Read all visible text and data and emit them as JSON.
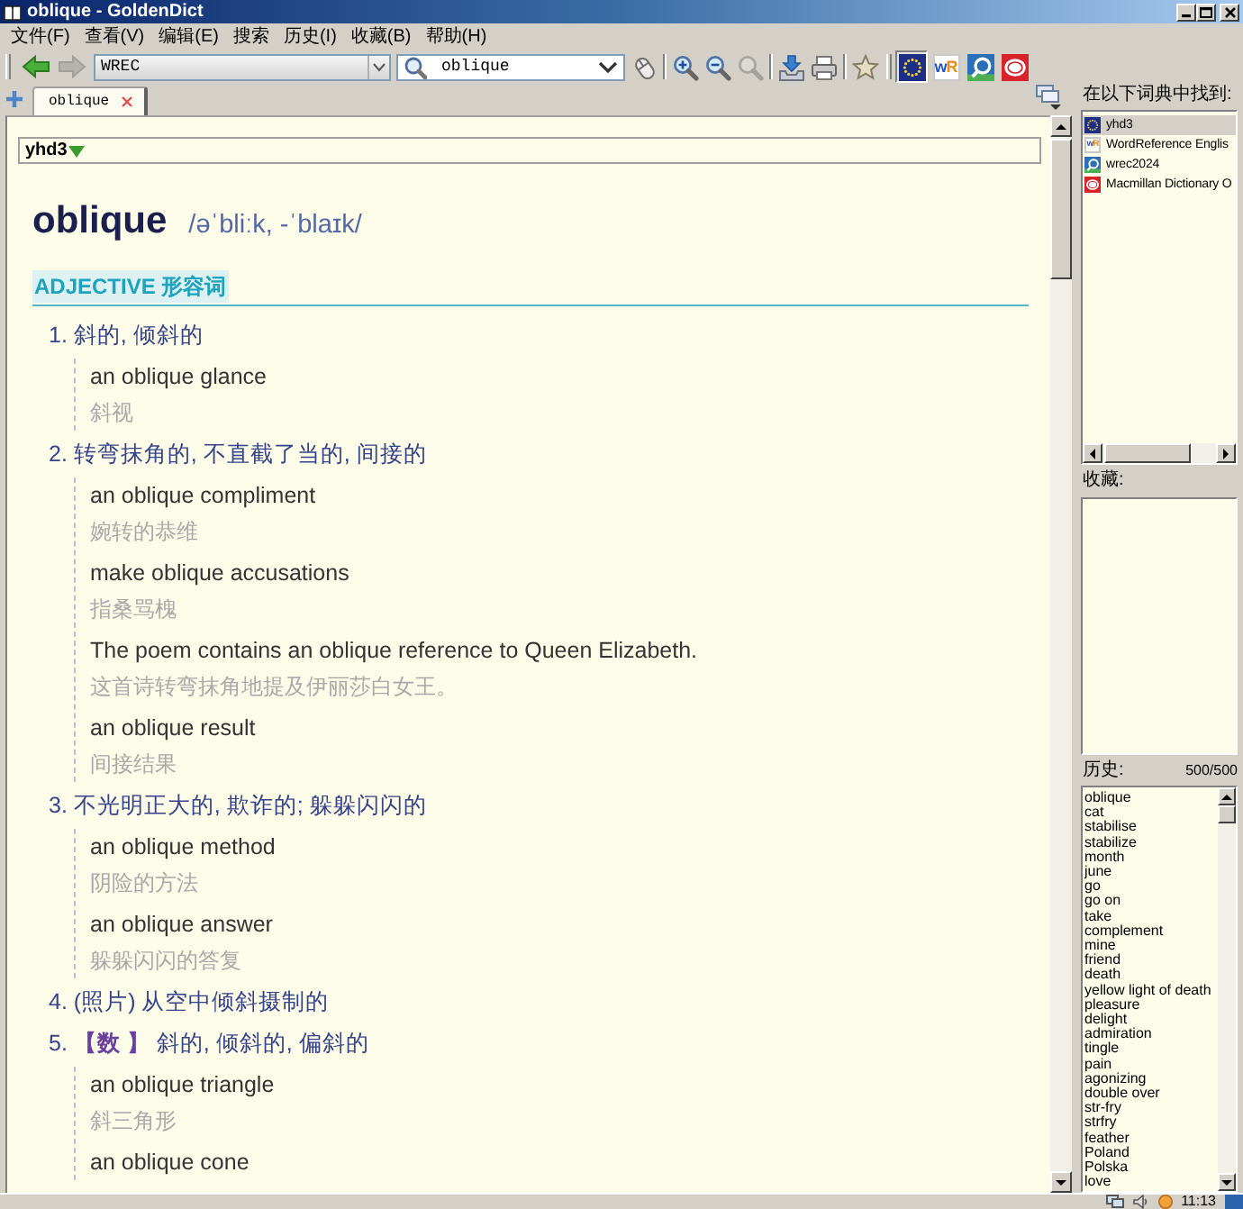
{
  "window": {
    "title": "oblique - GoldenDict"
  },
  "menu": [
    "文件(F)",
    "查看(V)",
    "编辑(E)",
    "搜索",
    "历史(I)",
    "收藏(B)",
    "帮助(H)"
  ],
  "toolbar": {
    "navigation": [
      {
        "kind": "back",
        "disabled": false
      },
      {
        "kind": "forward",
        "disabled": true
      }
    ],
    "dictionary_group": "WREC",
    "search": {
      "value": "oblique"
    },
    "tools": [
      {
        "kind": "scan",
        "disabled": false
      },
      {
        "kind": "zoom_in",
        "disabled": false
      },
      {
        "kind": "zoom_out",
        "disabled": false
      },
      {
        "kind": "zoom_reset",
        "disabled": true
      },
      {
        "kind": "save",
        "disabled": false
      },
      {
        "kind": "print",
        "disabled": false
      },
      {
        "kind": "favorite",
        "disabled": false
      }
    ],
    "dictionaries": [
      {
        "kind": "flag",
        "selected": true
      },
      {
        "kind": "letters",
        "logo": "wR",
        "selected": false
      },
      {
        "kind": "lens",
        "selected": false
      },
      {
        "kind": "badge",
        "selected": false
      }
    ]
  },
  "tabs": [
    {
      "label": "oblique",
      "selected": true
    }
  ],
  "article": {
    "dictionary": "yhd3",
    "expanded": true,
    "headword": "oblique",
    "phonetic": "/əˈbliːk, -ˈblaɪk/",
    "part_of_speech": "ADJECTIVE 形容词",
    "senses": [
      {
        "number": "1.",
        "text": "斜的, 倾斜的",
        "examples": [
          {
            "en": "an oblique glance",
            "zh": "斜视"
          }
        ]
      },
      {
        "number": "2.",
        "text": "转弯抹角的, 不直截了当的, 间接的",
        "examples": [
          {
            "en": "an oblique compliment",
            "zh": "婉转的恭维"
          },
          {
            "en": "make oblique accusations",
            "zh": "指桑骂槐"
          },
          {
            "en": "The poem contains an oblique reference to Queen Elizabeth.",
            "zh": "这首诗转弯抹角地提及伊丽莎白女王。"
          },
          {
            "en": "an oblique result",
            "zh": "间接结果"
          }
        ]
      },
      {
        "number": "3.",
        "text": "不光明正大的, 欺诈的; 躲躲闪闪的",
        "examples": [
          {
            "en": "an oblique method",
            "zh": "阴险的方法"
          },
          {
            "en": "an oblique answer",
            "zh": "躲躲闪闪的答复"
          }
        ]
      },
      {
        "number": "4.",
        "text": "(照片) 从空中倾斜摄制的"
      },
      {
        "number": "5.",
        "label": "【数 】",
        "text": "斜的, 倾斜的, 偏斜的",
        "examples": [
          {
            "en": "an oblique triangle",
            "zh": "斜三角形"
          },
          {
            "en": "an oblique cone"
          }
        ]
      }
    ]
  },
  "found_in": {
    "label": "在以下词典中找到:",
    "items": [
      {
        "name": "yhd3",
        "kind": "flag",
        "selected": true
      },
      {
        "name": "WordReference Englis",
        "kind": "letters",
        "logo": "wR",
        "selected": false
      },
      {
        "name": "wrec2024",
        "kind": "lens",
        "selected": false
      },
      {
        "name": "Macmillan Dictionary O",
        "kind": "badge",
        "selected": false
      }
    ]
  },
  "favorites": {
    "label": "收藏:"
  },
  "history": {
    "label": "历史:",
    "count": "500/500",
    "items": [
      "oblique",
      "cat",
      "stabilise",
      "stabilize",
      "month",
      "june",
      "go",
      "go on",
      "take",
      "complement",
      "mine",
      "friend",
      "death",
      "yellow light of death",
      "pleasure",
      "delight",
      "admiration",
      "tingle",
      "pain",
      "agonizing",
      "double over",
      "str-fry",
      "strfry",
      "feather",
      "Poland",
      "Polska",
      "love"
    ]
  },
  "status_bar": {
    "time": "11:13"
  }
}
